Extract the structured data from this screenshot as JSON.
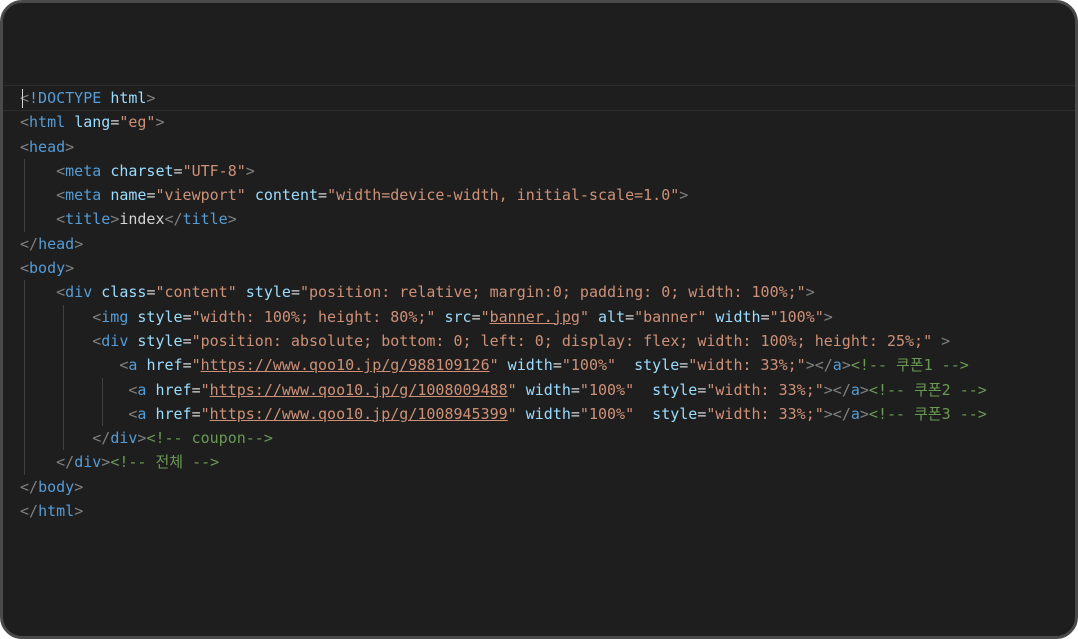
{
  "lines": [
    {
      "indent": 0,
      "cursor": true,
      "tokens": [
        {
          "k": "p",
          "t": "<"
        },
        {
          "k": "t",
          "t": "!DOCTYPE"
        },
        {
          "k": "x",
          "t": " "
        },
        {
          "k": "a",
          "t": "html"
        },
        {
          "k": "p",
          "t": ">"
        }
      ]
    },
    {
      "indent": 0,
      "tokens": [
        {
          "k": "p",
          "t": "<"
        },
        {
          "k": "t",
          "t": "html"
        },
        {
          "k": "x",
          "t": " "
        },
        {
          "k": "a",
          "t": "lang"
        },
        {
          "k": "x",
          "t": "="
        },
        {
          "k": "s",
          "t": "\"eg\""
        },
        {
          "k": "p",
          "t": ">"
        }
      ]
    },
    {
      "indent": 0,
      "tokens": [
        {
          "k": "p",
          "t": "<"
        },
        {
          "k": "t",
          "t": "head"
        },
        {
          "k": "p",
          "t": ">"
        }
      ]
    },
    {
      "indent": 4,
      "tokens": [
        {
          "k": "p",
          "t": "<"
        },
        {
          "k": "t",
          "t": "meta"
        },
        {
          "k": "x",
          "t": " "
        },
        {
          "k": "a",
          "t": "charset"
        },
        {
          "k": "x",
          "t": "="
        },
        {
          "k": "s",
          "t": "\"UTF-8\""
        },
        {
          "k": "p",
          "t": ">"
        }
      ]
    },
    {
      "indent": 4,
      "tokens": [
        {
          "k": "p",
          "t": "<"
        },
        {
          "k": "t",
          "t": "meta"
        },
        {
          "k": "x",
          "t": " "
        },
        {
          "k": "a",
          "t": "name"
        },
        {
          "k": "x",
          "t": "="
        },
        {
          "k": "s",
          "t": "\"viewport\""
        },
        {
          "k": "x",
          "t": " "
        },
        {
          "k": "a",
          "t": "content"
        },
        {
          "k": "x",
          "t": "="
        },
        {
          "k": "s",
          "t": "\"width=device-width, initial-scale=1.0\""
        },
        {
          "k": "p",
          "t": ">"
        }
      ]
    },
    {
      "indent": 4,
      "tokens": [
        {
          "k": "p",
          "t": "<"
        },
        {
          "k": "t",
          "t": "title"
        },
        {
          "k": "p",
          "t": ">"
        },
        {
          "k": "x",
          "t": "index"
        },
        {
          "k": "p",
          "t": "</"
        },
        {
          "k": "t",
          "t": "title"
        },
        {
          "k": "p",
          "t": ">"
        }
      ]
    },
    {
      "indent": 0,
      "tokens": [
        {
          "k": "p",
          "t": "</"
        },
        {
          "k": "t",
          "t": "head"
        },
        {
          "k": "p",
          "t": ">"
        }
      ]
    },
    {
      "indent": 0,
      "tokens": [
        {
          "k": "p",
          "t": "<"
        },
        {
          "k": "t",
          "t": "body"
        },
        {
          "k": "p",
          "t": ">"
        }
      ]
    },
    {
      "indent": 4,
      "tokens": [
        {
          "k": "p",
          "t": "<"
        },
        {
          "k": "t",
          "t": "div"
        },
        {
          "k": "x",
          "t": " "
        },
        {
          "k": "a",
          "t": "class"
        },
        {
          "k": "x",
          "t": "="
        },
        {
          "k": "s",
          "t": "\"content\""
        },
        {
          "k": "x",
          "t": " "
        },
        {
          "k": "a",
          "t": "style"
        },
        {
          "k": "x",
          "t": "="
        },
        {
          "k": "s",
          "t": "\"position: relative; margin:0; padding: 0; width: 100%;\""
        },
        {
          "k": "p",
          "t": ">"
        }
      ]
    },
    {
      "indent": 8,
      "tokens": [
        {
          "k": "p",
          "t": "<"
        },
        {
          "k": "t",
          "t": "img"
        },
        {
          "k": "x",
          "t": " "
        },
        {
          "k": "a",
          "t": "style"
        },
        {
          "k": "x",
          "t": "="
        },
        {
          "k": "s",
          "t": "\"width: 100%; height: 80%;\""
        },
        {
          "k": "x",
          "t": " "
        },
        {
          "k": "a",
          "t": "src"
        },
        {
          "k": "x",
          "t": "="
        },
        {
          "k": "s",
          "t": "\""
        },
        {
          "k": "u",
          "t": "banner.jpg"
        },
        {
          "k": "s",
          "t": "\""
        },
        {
          "k": "x",
          "t": " "
        },
        {
          "k": "a",
          "t": "alt"
        },
        {
          "k": "x",
          "t": "="
        },
        {
          "k": "s",
          "t": "\"banner\""
        },
        {
          "k": "x",
          "t": " "
        },
        {
          "k": "a",
          "t": "width"
        },
        {
          "k": "x",
          "t": "="
        },
        {
          "k": "s",
          "t": "\"100%\""
        },
        {
          "k": "p",
          "t": ">"
        }
      ]
    },
    {
      "indent": 8,
      "tokens": [
        {
          "k": "p",
          "t": "<"
        },
        {
          "k": "t",
          "t": "div"
        },
        {
          "k": "x",
          "t": " "
        },
        {
          "k": "a",
          "t": "style"
        },
        {
          "k": "x",
          "t": "="
        },
        {
          "k": "s",
          "t": "\"position: absolute; bottom: 0; left: 0; display: flex; width: 100%; height: 25%;\""
        },
        {
          "k": "x",
          "t": " "
        },
        {
          "k": "p",
          "t": ">"
        }
      ]
    },
    {
      "indent": 11,
      "tokens": [
        {
          "k": "p",
          "t": "<"
        },
        {
          "k": "t",
          "t": "a"
        },
        {
          "k": "x",
          "t": " "
        },
        {
          "k": "a",
          "t": "href"
        },
        {
          "k": "x",
          "t": "="
        },
        {
          "k": "s",
          "t": "\""
        },
        {
          "k": "u",
          "t": "https://www.qoo10.jp/g/988109126"
        },
        {
          "k": "s",
          "t": "\""
        },
        {
          "k": "x",
          "t": " "
        },
        {
          "k": "a",
          "t": "width"
        },
        {
          "k": "x",
          "t": "="
        },
        {
          "k": "s",
          "t": "\"100%\""
        },
        {
          "k": "x",
          "t": "  "
        },
        {
          "k": "a",
          "t": "style"
        },
        {
          "k": "x",
          "t": "="
        },
        {
          "k": "s",
          "t": "\"width: 33%;\""
        },
        {
          "k": "p",
          "t": "></"
        },
        {
          "k": "t",
          "t": "a"
        },
        {
          "k": "p",
          "t": ">"
        },
        {
          "k": "c",
          "t": "<!-- 쿠폰1 -->"
        }
      ]
    },
    {
      "indent": 12,
      "tokens": [
        {
          "k": "p",
          "t": "<"
        },
        {
          "k": "t",
          "t": "a"
        },
        {
          "k": "x",
          "t": " "
        },
        {
          "k": "a",
          "t": "href"
        },
        {
          "k": "x",
          "t": "="
        },
        {
          "k": "s",
          "t": "\""
        },
        {
          "k": "u",
          "t": "https://www.qoo10.jp/g/1008009488"
        },
        {
          "k": "s",
          "t": "\""
        },
        {
          "k": "x",
          "t": " "
        },
        {
          "k": "a",
          "t": "width"
        },
        {
          "k": "x",
          "t": "="
        },
        {
          "k": "s",
          "t": "\"100%\""
        },
        {
          "k": "x",
          "t": "  "
        },
        {
          "k": "a",
          "t": "style"
        },
        {
          "k": "x",
          "t": "="
        },
        {
          "k": "s",
          "t": "\"width: 33%;\""
        },
        {
          "k": "p",
          "t": "></"
        },
        {
          "k": "t",
          "t": "a"
        },
        {
          "k": "p",
          "t": ">"
        },
        {
          "k": "c",
          "t": "<!-- 쿠폰2 -->"
        }
      ]
    },
    {
      "indent": 12,
      "tokens": [
        {
          "k": "p",
          "t": "<"
        },
        {
          "k": "t",
          "t": "a"
        },
        {
          "k": "x",
          "t": " "
        },
        {
          "k": "a",
          "t": "href"
        },
        {
          "k": "x",
          "t": "="
        },
        {
          "k": "s",
          "t": "\""
        },
        {
          "k": "u",
          "t": "https://www.qoo10.jp/g/1008945399"
        },
        {
          "k": "s",
          "t": "\""
        },
        {
          "k": "x",
          "t": " "
        },
        {
          "k": "a",
          "t": "width"
        },
        {
          "k": "x",
          "t": "="
        },
        {
          "k": "s",
          "t": "\"100%\""
        },
        {
          "k": "x",
          "t": "  "
        },
        {
          "k": "a",
          "t": "style"
        },
        {
          "k": "x",
          "t": "="
        },
        {
          "k": "s",
          "t": "\"width: 33%;\""
        },
        {
          "k": "p",
          "t": "></"
        },
        {
          "k": "t",
          "t": "a"
        },
        {
          "k": "p",
          "t": ">"
        },
        {
          "k": "c",
          "t": "<!-- 쿠폰3 -->"
        }
      ]
    },
    {
      "indent": 8,
      "tokens": [
        {
          "k": "p",
          "t": "</"
        },
        {
          "k": "t",
          "t": "div"
        },
        {
          "k": "p",
          "t": ">"
        },
        {
          "k": "c",
          "t": "<!-- coupon-->"
        }
      ]
    },
    {
      "indent": 4,
      "tokens": [
        {
          "k": "p",
          "t": "</"
        },
        {
          "k": "t",
          "t": "div"
        },
        {
          "k": "p",
          "t": ">"
        },
        {
          "k": "c",
          "t": "<!-- 전체 -->"
        }
      ]
    },
    {
      "indent": 0,
      "tokens": [
        {
          "k": "p",
          "t": "</"
        },
        {
          "k": "t",
          "t": "body"
        },
        {
          "k": "p",
          "t": ">"
        }
      ]
    },
    {
      "indent": 0,
      "tokens": [
        {
          "k": "p",
          "t": "</"
        },
        {
          "k": "t",
          "t": "html"
        },
        {
          "k": "p",
          "t": ">"
        }
      ]
    }
  ]
}
